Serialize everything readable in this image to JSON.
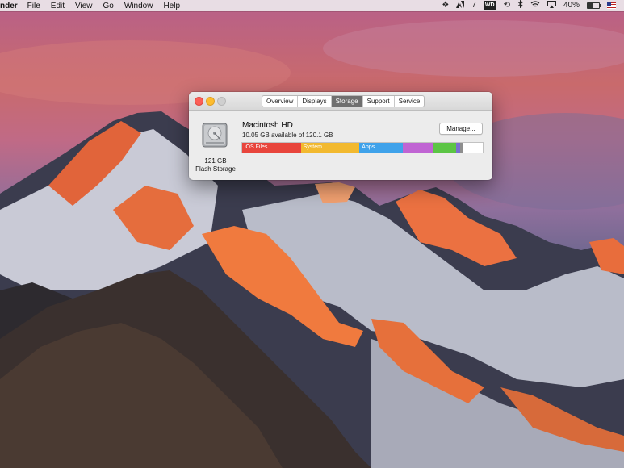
{
  "menubar": {
    "app_name": "nder",
    "items": [
      "File",
      "Edit",
      "View",
      "Go",
      "Window",
      "Help"
    ],
    "status": {
      "adobe_count": "7",
      "drive_badge": "WD",
      "battery_percent": "40%"
    },
    "icons": [
      "dropbox-icon",
      "adobe-icon",
      "wd-drive-icon",
      "time-machine-icon",
      "bluetooth-icon",
      "wifi-icon",
      "airplay-icon",
      "battery-icon",
      "flag-icon"
    ]
  },
  "window": {
    "tabs": [
      {
        "label": "Overview",
        "active": false
      },
      {
        "label": "Displays",
        "active": false
      },
      {
        "label": "Storage",
        "active": true
      },
      {
        "label": "Support",
        "active": false
      },
      {
        "label": "Service",
        "active": false
      }
    ],
    "disk": {
      "size": "121 GB",
      "type": "Flash Storage",
      "name": "Macintosh HD",
      "available": "10.05 GB available of 120.1 GB"
    },
    "manage_button": "Manage...",
    "segments": [
      {
        "label": "iOS Files",
        "fraction": 0.245,
        "color": "#e8453c"
      },
      {
        "label": "System",
        "fraction": 0.245,
        "color": "#f2b92f"
      },
      {
        "label": "Apps",
        "fraction": 0.18,
        "color": "#3fa2ea"
      },
      {
        "label": "",
        "fraction": 0.13,
        "color": "#c064d3"
      },
      {
        "label": "",
        "fraction": 0.095,
        "color": "#5cc545"
      },
      {
        "label": "",
        "fraction": 0.015,
        "color": "#7a6fd0"
      },
      {
        "label": "",
        "fraction": 0.005,
        "color": "#8e8e8e"
      },
      {
        "label": "",
        "fraction": 0.085,
        "color": "#ffffff"
      }
    ]
  }
}
